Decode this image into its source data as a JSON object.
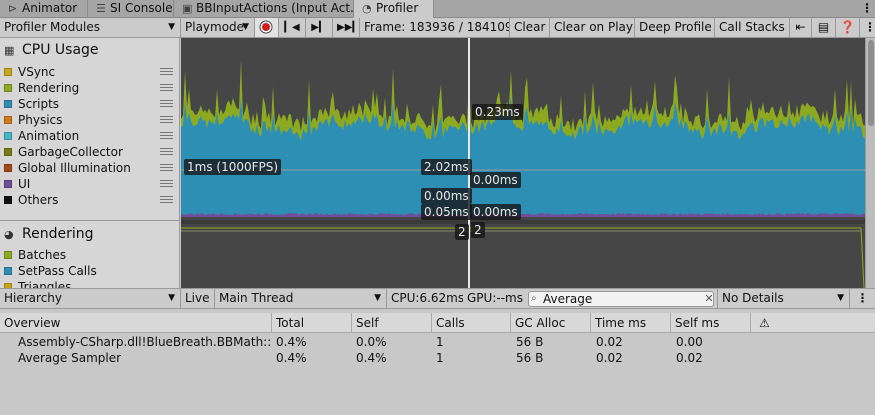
{
  "tabs": [
    {
      "label": "Animator",
      "icon": "animator-icon"
    },
    {
      "label": "SI Console",
      "icon": "console-icon"
    },
    {
      "label": "BBInputActions (Input Act...",
      "icon": "input-actions-icon"
    },
    {
      "label": "Profiler",
      "icon": "profiler-icon",
      "active": true
    }
  ],
  "toolbar": {
    "modules_label": "Profiler Modules",
    "playmode_label": "Playmode",
    "frame_label": "Frame: 183936 / 184109",
    "clear_label": "Clear",
    "clear_on_play_label": "Clear on Play",
    "deep_profile_label": "Deep Profile",
    "call_stacks_label": "Call Stacks"
  },
  "cpu_module": {
    "title": "CPU Usage",
    "items": [
      {
        "label": "VSync",
        "color": "#c8a418"
      },
      {
        "label": "Rendering",
        "color": "#8da91f"
      },
      {
        "label": "Scripts",
        "color": "#2e8fb5"
      },
      {
        "label": "Physics",
        "color": "#d27a16"
      },
      {
        "label": "Animation",
        "color": "#46b5cc"
      },
      {
        "label": "GarbageCollector",
        "color": "#7a7a14"
      },
      {
        "label": "Global Illumination",
        "color": "#a34a12"
      },
      {
        "label": "UI",
        "color": "#6f4f9a"
      },
      {
        "label": "Others",
        "color": "#111111"
      }
    ]
  },
  "rendering_module": {
    "title": "Rendering",
    "items": [
      {
        "label": "Batches",
        "color": "#8da91f"
      },
      {
        "label": "SetPass Calls",
        "color": "#2e8fb5"
      },
      {
        "label": "Triangles",
        "color": "#c8a418"
      }
    ]
  },
  "chart_labels": {
    "fps_line": "1ms (1000FPS)",
    "rendering_value": "0.23ms",
    "scripts_left": "2.02ms",
    "scripts_right": "0.00ms",
    "others_left": "0.00ms",
    "ui_left": "0.05ms",
    "ui_right": "0.00ms",
    "batches_left": "2",
    "batches_right": "2"
  },
  "lower_toolbar": {
    "view_label": "Hierarchy",
    "live_label": "Live",
    "thread_label": "Main Thread",
    "cpu_label": "CPU:6.62ms",
    "gpu_label": "GPU:--ms",
    "search_value": "Average",
    "details_label": "No Details"
  },
  "table": {
    "columns": [
      "Overview",
      "Total",
      "Self",
      "Calls",
      "GC Alloc",
      "Time ms",
      "Self ms"
    ],
    "rows": [
      [
        "Assembly-CSharp.dll!BlueBreath.BBMath::Av",
        "0.4%",
        "0.0%",
        "1",
        "56 B",
        "0.02",
        "0.00"
      ],
      [
        "Average Sampler",
        "0.4%",
        "0.4%",
        "1",
        "56 B",
        "0.02",
        "0.02"
      ]
    ]
  }
}
